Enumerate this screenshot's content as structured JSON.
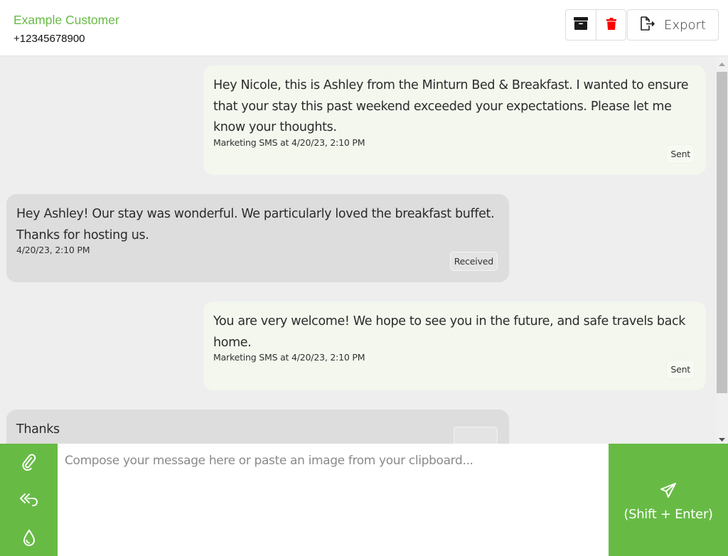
{
  "header": {
    "contact_name": "Example Customer",
    "contact_phone": "+12345678900",
    "archive_icon": "archive-box-icon",
    "delete_icon": "trash-icon",
    "export_icon": "file-export-icon",
    "export_label": "Export"
  },
  "messages": [
    {
      "direction": "sent",
      "text": "Hey Nicole, this is Ashley from the Minturn Bed & Breakfast. I wanted to ensure that your stay this past weekend exceeded your expectations. Please let me know your thoughts.",
      "meta": "Marketing SMS at 4/20/23, 2:10 PM",
      "status": "Sent"
    },
    {
      "direction": "received",
      "text": "Hey Ashley! Our stay was wonderful. We particularly loved the breakfast buffet. Thanks for hosting us.",
      "meta": "4/20/23, 2:10 PM",
      "status": "Received"
    },
    {
      "direction": "sent",
      "text": "You are very welcome! We hope to see you in the future, and safe travels back home.",
      "meta": "Marketing SMS at 4/20/23, 2:10 PM",
      "status": "Sent"
    },
    {
      "direction": "received",
      "text": "Thanks",
      "meta": "",
      "status": ""
    }
  ],
  "composer": {
    "placeholder": "Compose your message here or paste an image from your clipboard...",
    "value": "",
    "tools": [
      "paperclip-icon",
      "reply-all-icon",
      "drop-icon"
    ],
    "send_icon": "paper-plane-icon",
    "send_label": "(Shift + Enter)"
  },
  "colors": {
    "brand_green": "#67bb45",
    "delete_red": "#ff0000",
    "sent_bubble": "#f3f7ee",
    "received_bubble": "#dddddd",
    "thread_background": "#eeeeee"
  }
}
